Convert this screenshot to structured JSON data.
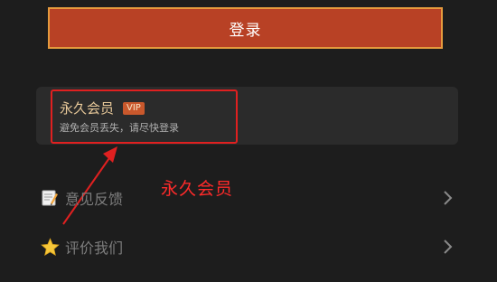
{
  "login": {
    "label": "登录"
  },
  "membership": {
    "title": "永久会员",
    "badge": "VIP",
    "subtitle": "避免会员丢失，请尽快登录"
  },
  "annotation": {
    "label": "永久会员",
    "color": "#e02020"
  },
  "menu": {
    "items": [
      {
        "label": "意见反馈",
        "icon": "memo-icon"
      },
      {
        "label": "评价我们",
        "icon": "star-icon"
      }
    ]
  },
  "colors": {
    "background": "#1d1d1d",
    "login_button": "#b84125",
    "login_border": "#e59a3d",
    "card": "#2b2b2b",
    "member_title": "#e8c99a",
    "vip_badge": "#c9582c"
  }
}
